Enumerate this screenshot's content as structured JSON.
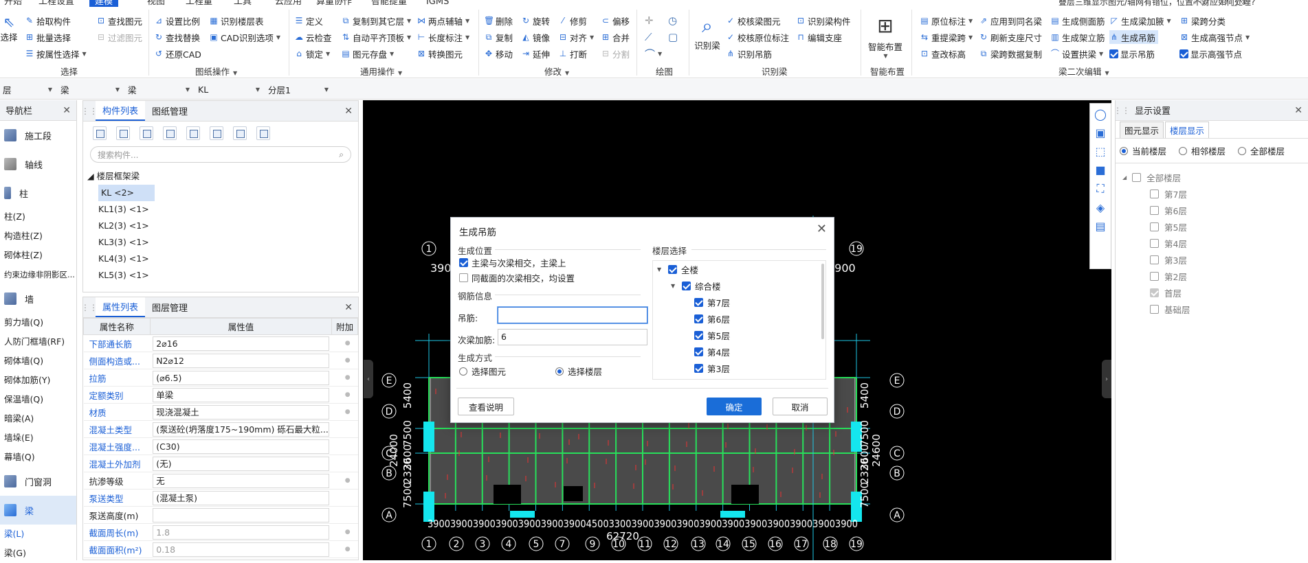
{
  "app": {
    "title": "叠层三维显示图元/轴网有错位，位置不对应如何处理?"
  },
  "menu": [
    "开始",
    "工程设置",
    "建模",
    "视图",
    "工程量",
    "工具",
    "云应用",
    "算量协作",
    "智能提量",
    "IGMS"
  ],
  "ribbon": {
    "select": {
      "big": "选择",
      "pick": "拾取构件",
      "batch": "批量选择",
      "byattr": "按属性选择",
      "find": "查找图元",
      "filter": "过滤图元",
      "group": "选择"
    },
    "drawing": {
      "ratio": "设置比例",
      "findrep": "查找替换",
      "restore": "还原CAD",
      "floor": "识别楼层表",
      "cadopt": "CAD识别选项",
      "group": "图纸操作"
    },
    "common": {
      "define": "定义",
      "cloud": "云检查",
      "lock": "锁定",
      "copyfl": "复制到其它层",
      "autoflat": "自动平齐顶板",
      "elemsave": "图元存盘",
      "twopt": "两点辅轴",
      "length": "长度标注",
      "convert": "转换图元",
      "group": "通用操作"
    },
    "modify": {
      "del": "删除",
      "copy": "复制",
      "move": "移动",
      "rotate": "旋转",
      "mirror": "镜像",
      "extend": "延伸",
      "trim": "修剪",
      "align": "对齐",
      "break": "打断",
      "offset": "偏移",
      "merge": "合并",
      "split": "分割",
      "group": "修改"
    },
    "draw": {
      "group": "绘图"
    },
    "recbeam": {
      "big": "识别梁",
      "checkbeam": "校核梁图元",
      "checkorig": "校核原位标注",
      "hanger": "识别吊筋",
      "recbeamcomp": "识别梁构件",
      "editsup": "编辑支座",
      "group": "识别梁"
    },
    "smart": {
      "big": "智能布置",
      "group": "智能布置"
    },
    "beam2": {
      "origmark": "原位标注",
      "respan": "重提梁跨",
      "checkheight": "查改标高",
      "applysame": "应用到同名梁",
      "refreshsup": "刷新支座尺寸",
      "spandata": "梁跨数据复制",
      "sidebar": "生成侧面筋",
      "genstirrup": "生成架立筋",
      "archang": "设置拱梁",
      "genhaunch": "生成梁加腋",
      "genhanger": "生成吊筋",
      "showhanger": "显示吊筋",
      "spanclass": "梁跨分类",
      "genhigh": "生成高强节点",
      "showhigh": "显示高强节点",
      "group": "梁二次编辑"
    }
  },
  "filterbar": {
    "layer": "层",
    "type1": "梁",
    "type2": "梁",
    "type3": "KL",
    "floor": "分层1"
  },
  "nav": {
    "title": "导航栏",
    "cats": [
      "施工段",
      "轴线",
      "柱"
    ],
    "col_items": [
      "柱(Z)",
      "构造柱(Z)",
      "砌体柱(Z)",
      "约束边缘非阴影区..."
    ],
    "wall": "墙",
    "wall_items": [
      "剪力墙(Q)",
      "人防门框墙(RF)",
      "砌体墙(Q)",
      "砌体加筋(Y)",
      "保温墙(Q)",
      "暗梁(A)",
      "墙垛(E)",
      "幕墙(Q)"
    ],
    "door": "门窗洞",
    "beam": "梁",
    "beam_items": [
      "梁(L)",
      "梁(G)"
    ]
  },
  "complist": {
    "tab1": "构件列表",
    "tab2": "图纸管理",
    "search_placeholder": "搜索构件...",
    "root": "楼层框架梁",
    "items": [
      "KL <2>",
      "KL1(3) <1>",
      "KL2(3) <1>",
      "KL3(3) <1>",
      "KL4(3) <1>",
      "KL5(3) <1>"
    ]
  },
  "props": {
    "tab1": "属性列表",
    "tab2": "图层管理",
    "h_name": "属性名称",
    "h_value": "属性值",
    "h_add": "附加",
    "rows": [
      {
        "n": "下部通长筋",
        "v": "2⌀16",
        "blue": true
      },
      {
        "n": "侧面构造或...",
        "v": "N2⌀12",
        "blue": true
      },
      {
        "n": "拉筋",
        "v": "(⌀6.5)",
        "blue": true
      },
      {
        "n": "定额类别",
        "v": "单梁",
        "blue": true
      },
      {
        "n": "材质",
        "v": "现浇混凝土",
        "blue": true
      },
      {
        "n": "混凝土类型",
        "v": "(泵送砼(坍落度175~190mm) 砾石最大粒...",
        "blue": true
      },
      {
        "n": "混凝土强度...",
        "v": "(C30)",
        "blue": true
      },
      {
        "n": "混凝土外加剂",
        "v": "(无)",
        "blue": true
      },
      {
        "n": "抗渗等级",
        "v": "无",
        "blue": false
      },
      {
        "n": "泵送类型",
        "v": "(混凝土泵)",
        "blue": true
      },
      {
        "n": "泵送高度(m)",
        "v": "",
        "blue": false
      },
      {
        "n": "截面周长(m)",
        "v": "1.8",
        "blue": true,
        "gray": true
      },
      {
        "n": "截面面积(m²)",
        "v": "0.18",
        "blue": true,
        "gray": true
      }
    ]
  },
  "canvas": {
    "axes_top": [
      "1",
      "19"
    ],
    "axes_bottom": [
      "1",
      "2",
      "3",
      "4",
      "5",
      "7",
      "9",
      "10",
      "11",
      "12",
      "13",
      "14",
      "15",
      "16",
      "17",
      "18",
      "19"
    ],
    "rows": [
      "E",
      "D",
      "C",
      "B",
      "A"
    ],
    "dim_top": [
      "3900",
      "3900"
    ],
    "dim_bottom": "3900390039003900390039003900450033003900390039003900390039003900390039003900",
    "total": "62720",
    "left_dims": [
      "5400",
      "7500",
      "3600",
      "24000",
      "2320",
      "7500"
    ],
    "right_dims": [
      "5400",
      "7500",
      "3600",
      "24600",
      "2320",
      "7500"
    ]
  },
  "dialog": {
    "title": "生成吊筋",
    "pos_section": "生成位置",
    "opt1": "主梁与次梁相交，主梁上",
    "opt2": "同截面的次梁相交，均设置",
    "rebar_section": "钢筋信息",
    "hanger_label": "吊筋:",
    "hanger_value": "",
    "extra_label": "次梁加筋:",
    "extra_value": "6",
    "method_section": "生成方式",
    "m1": "选择图元",
    "m2": "选择楼层",
    "floor_section": "楼层选择",
    "tree": [
      "全楼",
      "综合楼",
      "第7层",
      "第6层",
      "第5层",
      "第4层",
      "第3层"
    ],
    "help": "查看说明",
    "ok": "确定",
    "cancel": "取消"
  },
  "dispset": {
    "title": "显示设置",
    "tab1": "图元显示",
    "tab2": "楼层显示",
    "r1": "当前楼层",
    "r2": "相邻楼层",
    "r3": "全部楼层",
    "all": "全部楼层",
    "floors": [
      "第7层",
      "第6层",
      "第5层",
      "第4层",
      "第3层",
      "第2层",
      "首层",
      "基础层"
    ]
  }
}
